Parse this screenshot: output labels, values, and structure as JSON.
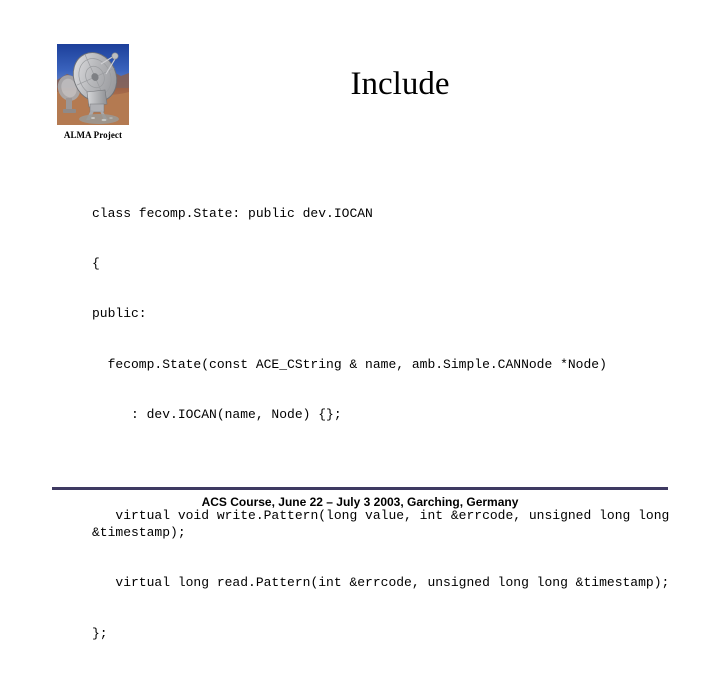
{
  "slide": {
    "title": "Include",
    "logo": {
      "caption": "ALMA Project",
      "image_alt": "ALMA radio telescope antenna on desert plateau"
    },
    "code_lines": [
      "class fecomp.State: public dev.IOCAN",
      "{",
      "public:",
      "  fecomp.State(const ACE_CString & name, amb.Simple.CANNode *Node)",
      "     : dev.IOCAN(name, Node) {};",
      "",
      "   virtual void write.Pattern(long value, int &errcode, unsigned long long &timestamp);",
      "   virtual long read.Pattern(int &errcode, unsigned long long &timestamp);",
      "};"
    ],
    "footer": {
      "text": "ACS Course, June 22 –  July 3 2003, Garching, Germany",
      "rule_color": "#3e3a62"
    }
  }
}
